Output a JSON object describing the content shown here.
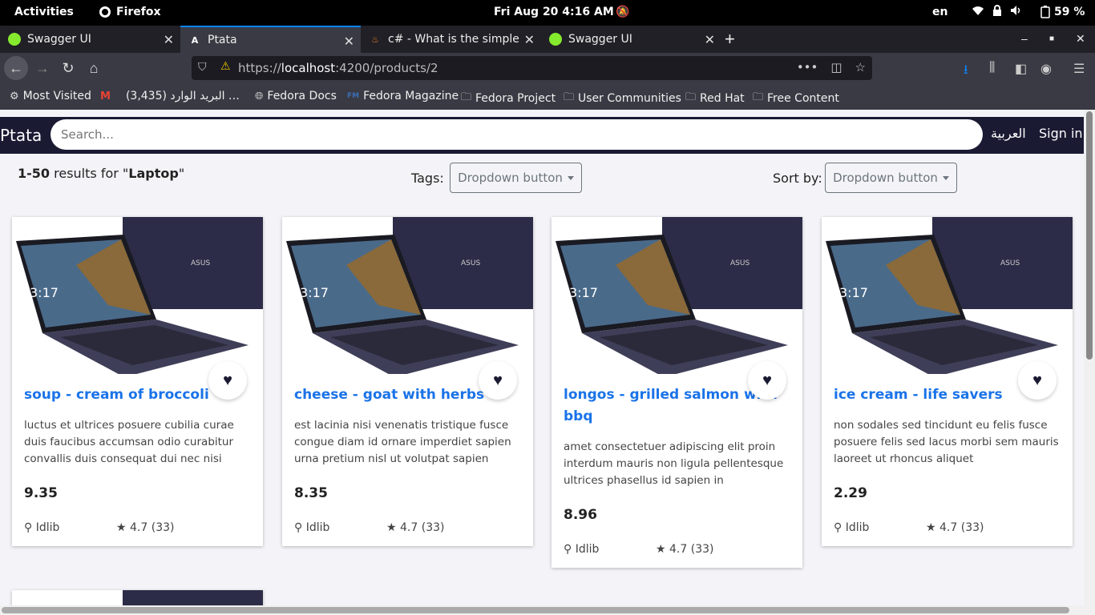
{
  "system": {
    "activities": "Activities",
    "app": "Firefox",
    "clock": "Fri Aug 20  4:16 AM",
    "lang": "en",
    "battery": "59 %"
  },
  "tabs": [
    {
      "label": "Swagger UI",
      "icon": "swagger-icon"
    },
    {
      "label": "Ptata",
      "icon": "angular-icon"
    },
    {
      "label": "c# - What is the simplest",
      "icon": "stackoverflow-icon"
    },
    {
      "label": "Swagger UI",
      "icon": "swagger-icon"
    }
  ],
  "url": {
    "prefix": "https://",
    "host": "localhost",
    "rest": ":4200/products/2"
  },
  "bookmarks": [
    {
      "label": "Most Visited",
      "icon": "gear-icon"
    },
    {
      "label": "البريد الوارد (3,435) …",
      "icon": "gmail-icon"
    },
    {
      "label": "Fedora Docs",
      "icon": "globe-icon"
    },
    {
      "label": "Fedora Magazine",
      "icon": "fm-icon"
    },
    {
      "label": "Fedora Project",
      "icon": "folder-icon"
    },
    {
      "label": "User Communities",
      "icon": "folder-icon"
    },
    {
      "label": "Red Hat",
      "icon": "folder-icon"
    },
    {
      "label": "Free Content",
      "icon": "folder-icon"
    }
  ],
  "app": {
    "brand": "Ptata",
    "search_placeholder": "Search...",
    "lang_link": "العربية",
    "signin": "Sign in"
  },
  "results": {
    "range": "1-50",
    "text": " results for \"",
    "query": "Laptop",
    "close": "\""
  },
  "filters": {
    "tags_label": "Tags:",
    "tags_button": "Dropdown button",
    "sort_label": "Sort by:",
    "sort_button": "Dropdown button"
  },
  "products": [
    {
      "title": "soup - cream of broccoli",
      "desc": "luctus et ultrices posuere cubilia curae duis faucibus accumsan odio curabitur convallis duis consequat dui nec nisi",
      "price": "9.35",
      "location": "Idlib",
      "rating": "4.7 (33)"
    },
    {
      "title": "cheese - goat with herbs",
      "desc": "est lacinia nisi venenatis tristique fusce congue diam id ornare imperdiet sapien urna pretium nisl ut volutpat sapien",
      "price": "8.35",
      "location": "Idlib",
      "rating": "4.7 (33)"
    },
    {
      "title": "longos - grilled salmon with bbq",
      "desc": "amet consectetuer adipiscing elit proin interdum mauris non ligula pellentesque ultrices phasellus id sapien in",
      "price": "8.96",
      "location": "Idlib",
      "rating": "4.7 (33)"
    },
    {
      "title": "ice cream - life savers",
      "desc": "non sodales sed tincidunt eu felis fusce posuere felis sed lacus morbi sem mauris laoreet ut rhoncus aliquet",
      "price": "2.29",
      "location": "Idlib",
      "rating": "4.7 (33)"
    }
  ],
  "colors": {
    "accent": "#1a73e8",
    "appbar": "#1a1a33",
    "tab_accent": "#0a84ff"
  }
}
